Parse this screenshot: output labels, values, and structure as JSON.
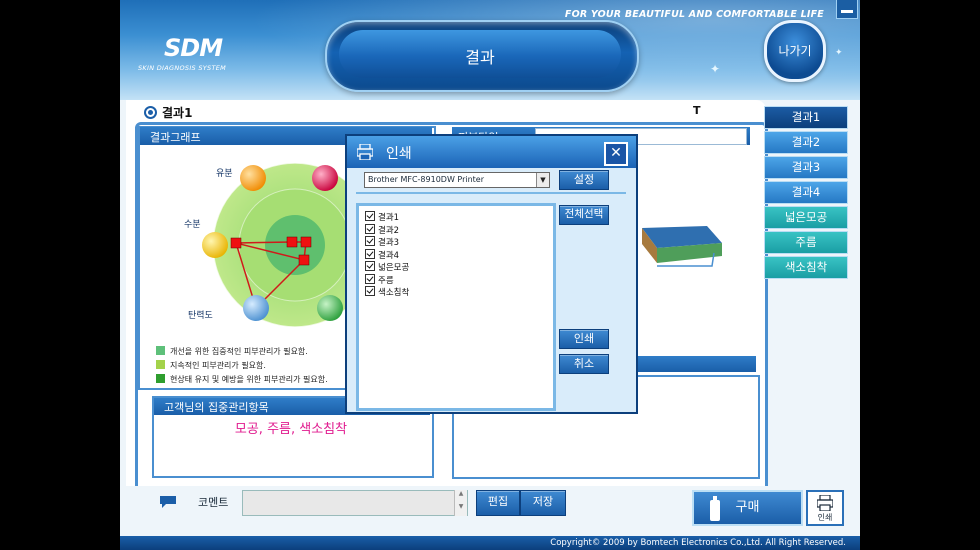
{
  "header": {
    "slogan": "FOR YOUR BEAUTIFUL AND COMFORTABLE LIFE",
    "logo": "SDM",
    "logo_sub": "SKIN DIAGNOSIS SYSTEM",
    "title": "결과",
    "exit_label": "나가기"
  },
  "main": {
    "result_header": "결과1",
    "t_label": "T",
    "graph_title": "결과그래프",
    "skin_type_title": "피부타입",
    "chart_labels": {
      "oil": "유분",
      "moisture": "수분",
      "elasticity": "탄력도"
    },
    "legend": [
      {
        "text": "개선을 위한 집중적인 피부관리가 필요함.",
        "color": "#5ec07a"
      },
      {
        "text": "지속적인 피부관리가 필요함.",
        "color": "#a3d24a"
      },
      {
        "text": "현상태 유지 및 예방을 위한 피부관리가 필요함.",
        "color": "#2f9e2f"
      }
    ],
    "focus_title": "고객님의 집중관리항목",
    "focus_value": "모공, 주름, 색소침착"
  },
  "tabs": [
    {
      "label": "결과1",
      "type": "result",
      "active": true
    },
    {
      "label": "결과2",
      "type": "result",
      "active": false
    },
    {
      "label": "결과3",
      "type": "result",
      "active": false
    },
    {
      "label": "결과4",
      "type": "result",
      "active": false
    },
    {
      "label": "넓은모공",
      "type": "other",
      "active": false
    },
    {
      "label": "주름",
      "type": "other",
      "active": false
    },
    {
      "label": "색소침착",
      "type": "other",
      "active": false
    }
  ],
  "bottom": {
    "comment_label": "코멘트",
    "comment_value": "",
    "edit_label": "편집",
    "save_label": "저장",
    "buy_label": "구매",
    "print_label": "인쇄",
    "copyright": "Copyright© 2009 by Bomtech Electronics Co.,Ltd.  All Right Reserved."
  },
  "print_dialog": {
    "title": "인쇄",
    "close_symbol": "✕",
    "printer": "Brother MFC-8910DW Printer",
    "settings_label": "설정",
    "select_all_label": "전체선택",
    "print_label": "인쇄",
    "cancel_label": "취소",
    "items": [
      {
        "label": "결과1",
        "checked": true
      },
      {
        "label": "결과2",
        "checked": true
      },
      {
        "label": "결과3",
        "checked": true
      },
      {
        "label": "결과4",
        "checked": true
      },
      {
        "label": "넓은모공",
        "checked": true
      },
      {
        "label": "주름",
        "checked": true
      },
      {
        "label": "색소침착",
        "checked": true
      }
    ]
  }
}
